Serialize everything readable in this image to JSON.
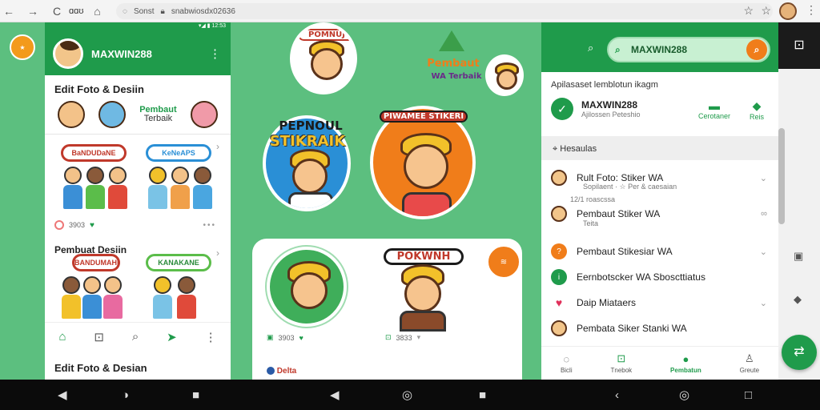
{
  "browser": {
    "back": "←",
    "forward": "→",
    "reload": "C",
    "title_short": "ɑɑʊ",
    "home": "⌂",
    "tab_text": "Sonst",
    "url": "snabwiosdx02636",
    "star": "☆",
    "star2": "☆",
    "menu": "⋮"
  },
  "left_phone": {
    "status": "▾◢ ▮ 12:53",
    "name": "MAXWIN288",
    "dots": "⋮",
    "section_title": "Edit Foto & Desiin",
    "tag_title": "Pembaut",
    "tag_sub": "Terbaik",
    "card1": {
      "banner_a": "BaNDUDaNE",
      "banner_b": "KeNeAPS",
      "meta": "3903",
      "dots": "•••",
      "chev": "›"
    },
    "card2": {
      "title": "Pembuat Desiin",
      "banner_a": "BANDUMAHE",
      "banner_b": "KANAKANE",
      "chev": "›"
    },
    "tabs": [
      "⌂",
      "⊡",
      "⌕",
      "➤",
      "⋮"
    ],
    "bottom_title": "Edit Foto & Desian"
  },
  "center": {
    "top_sticker_label": "POMNUJ",
    "logo_text_a": "Pembaut",
    "logo_text_b": "WA Terbaik",
    "big_left_label_a": "PEPNOUL",
    "big_left_label_b": "STIKRAIK",
    "big_right_label": "PIWAMEE STIKERI",
    "card_sticker_label": "POKWNH",
    "orange_btn": "≋",
    "meta_left": "3903",
    "meta_right": "3833",
    "bottom_text": "Delta"
  },
  "right_phone": {
    "search_icon": "⌕",
    "search_value": "MAXWIN288",
    "subtitle": "Apilasaset lemblotun ikagm",
    "contact_name": "MAXWIN288",
    "contact_sub": "Ajilossen Peteshio",
    "act1": "Cerotaner",
    "act2": "Reis",
    "section": "Hesaulas",
    "items": [
      {
        "label": "Rult Foto: Stiker WA",
        "sub": "Sopilaent · ☆ Per & caesaian"
      },
      {
        "label": "Pembaut Stiker WA",
        "sub": "Teita",
        "pre": "12/1 roascssa"
      },
      {
        "label": "Pembaut Stikesiar WA",
        "sub": ""
      },
      {
        "label": "Eernbotscker WA Sboscttiatus",
        "sub": ""
      },
      {
        "label": "Daip Miataers",
        "sub": ""
      },
      {
        "label": "Pembata Siker Stanki WA",
        "sub": ""
      }
    ],
    "tabs": [
      {
        "icon": "◌",
        "label": "Bicli"
      },
      {
        "icon": "⊡",
        "label": "Tnebok"
      },
      {
        "icon": "●",
        "label": "Pembatun"
      },
      {
        "icon": "♙",
        "label": "Greute"
      }
    ]
  },
  "strip": {
    "top": "⊡",
    "fab": "⇄"
  },
  "sysnav": [
    "◀",
    "◑",
    "■",
    "◀",
    "◎",
    "■",
    "‹",
    "◎",
    "□"
  ]
}
